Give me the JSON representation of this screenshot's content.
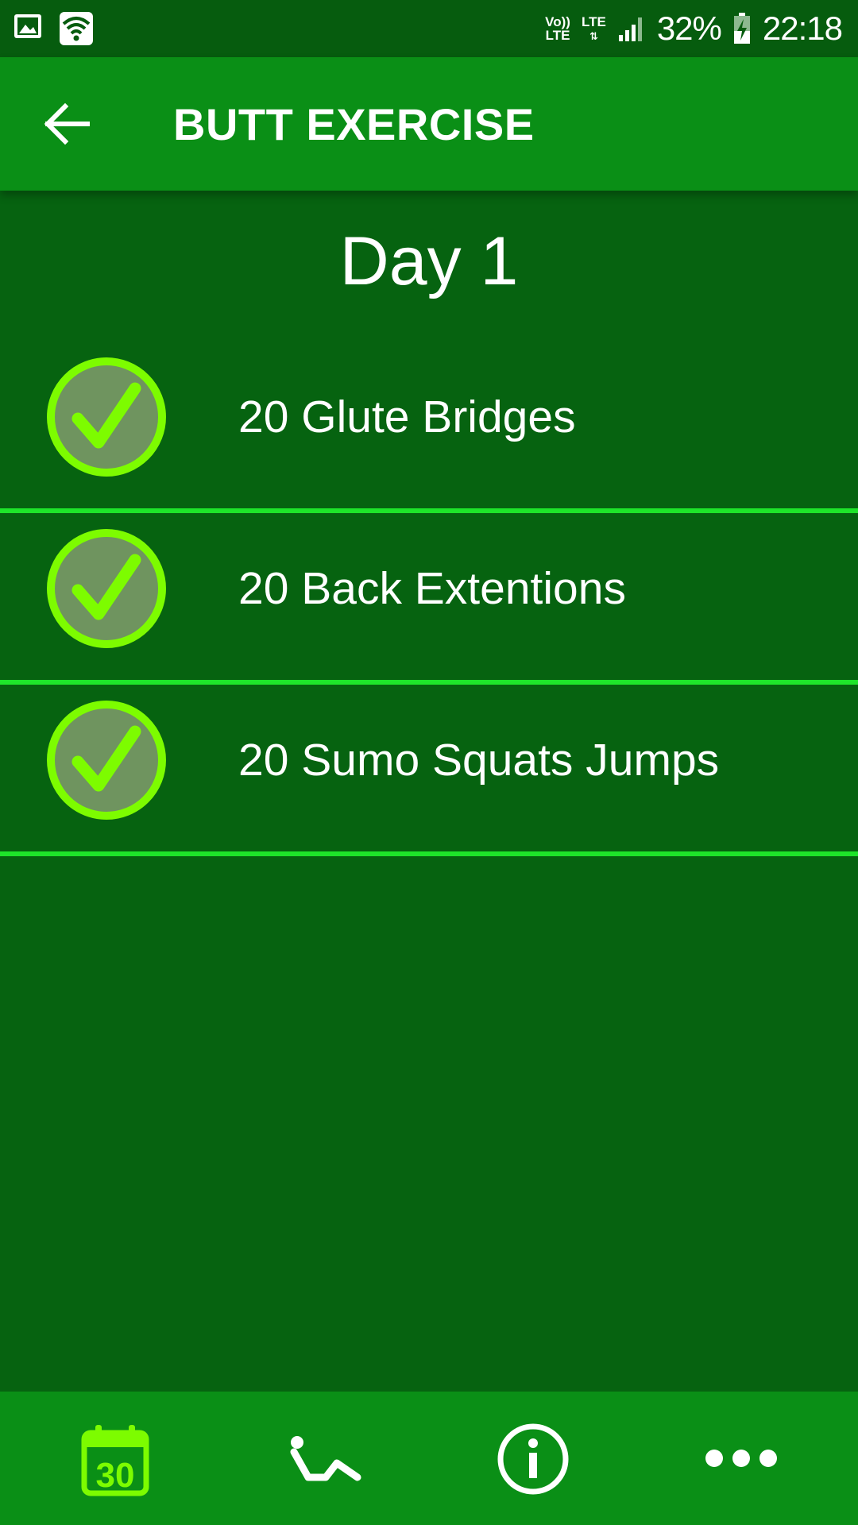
{
  "status_bar": {
    "volte": "Vo))\nLTE",
    "lte": "LTE",
    "battery_percent": "32%",
    "time": "22:18",
    "icons": [
      "gallery-icon",
      "wifi-icon",
      "volte-icon",
      "lte-icon",
      "signal-icon",
      "battery-charging-icon"
    ]
  },
  "app_bar": {
    "title": "BUTT EXERCISE",
    "back_icon": "arrow-back-icon"
  },
  "day": {
    "title": "Day 1"
  },
  "exercises": [
    {
      "label": "20 Glute Bridges",
      "done": true
    },
    {
      "label": "20 Back Extentions",
      "done": true
    },
    {
      "label": "20 Sumo Squats Jumps",
      "done": true
    }
  ],
  "bottom_nav": {
    "items": [
      {
        "icon": "calendar-icon",
        "calendar_number": "30",
        "active": true
      },
      {
        "icon": "exercise-icon",
        "active": false
      },
      {
        "icon": "info-icon",
        "active": false
      },
      {
        "icon": "more-icon",
        "active": false
      }
    ]
  },
  "colors": {
    "status_bar": "#065c0e",
    "app_bar": "#0a8f16",
    "background": "#066310",
    "divider": "#1ee52a",
    "check_ring": "#7dfc00",
    "check_fill": "#6f945f",
    "active_nav": "#7dfc00"
  }
}
